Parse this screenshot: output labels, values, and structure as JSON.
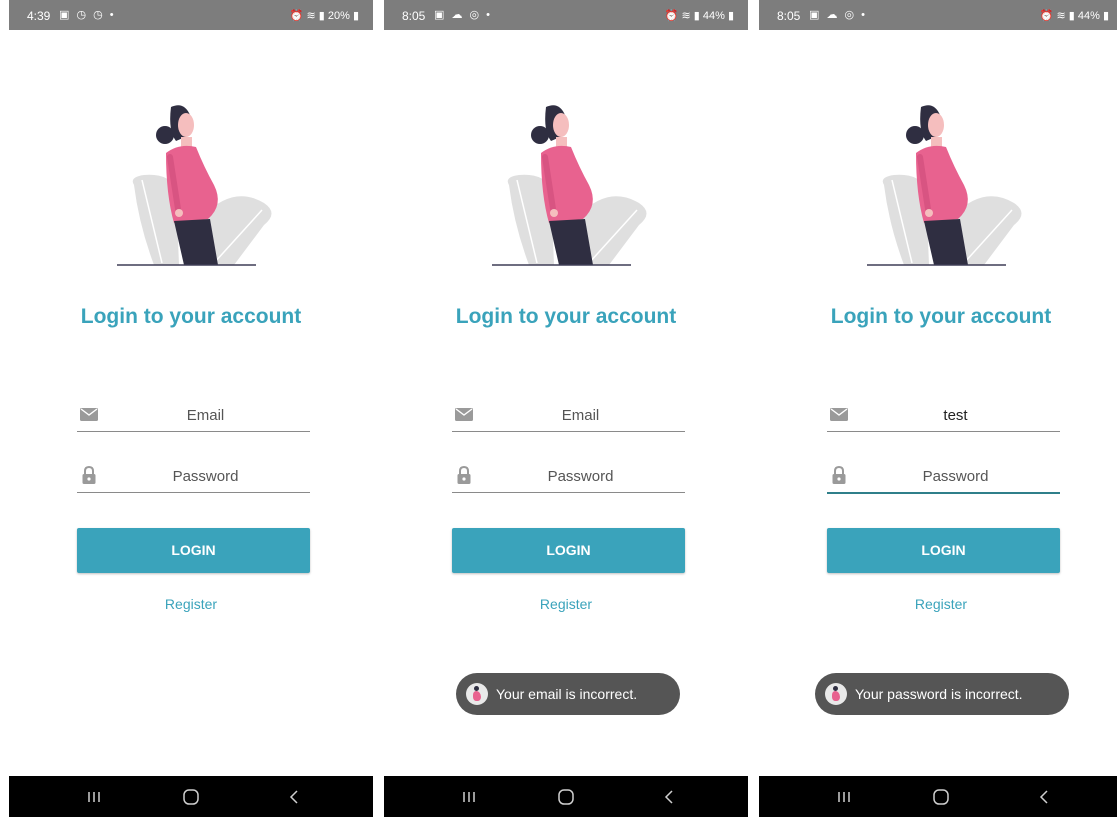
{
  "colors": {
    "accent": "#3aa3bb",
    "statusbar": "#7d7d7d",
    "toast_bg": "#555555",
    "navbar": "#000000",
    "focus_underline": "#2f7f8a"
  },
  "screens": [
    {
      "status": {
        "time": "4:39",
        "battery": "20%"
      },
      "title": "Login to your account",
      "email": {
        "value": "",
        "placeholder": "Email"
      },
      "password": {
        "value": "",
        "placeholder": "Password"
      },
      "login_label": "LOGIN",
      "register_label": "Register",
      "toast": null
    },
    {
      "status": {
        "time": "8:05",
        "battery": "44%"
      },
      "title": "Login to your account",
      "email": {
        "value": "",
        "placeholder": "Email"
      },
      "password": {
        "value": "",
        "placeholder": "Password"
      },
      "login_label": "LOGIN",
      "register_label": "Register",
      "toast": "Your email is incorrect."
    },
    {
      "status": {
        "time": "8:05",
        "battery": "44%"
      },
      "title": "Login to your account",
      "email": {
        "value": "test",
        "placeholder": "Email"
      },
      "password": {
        "value": "",
        "placeholder": "Password",
        "focused": true
      },
      "login_label": "LOGIN",
      "register_label": "Register",
      "toast": "Your password is incorrect."
    }
  ],
  "icons": [
    "email-icon",
    "lock-icon",
    "recent-apps-icon",
    "home-icon",
    "back-icon",
    "alarm-icon",
    "wifi-icon",
    "signal-icon",
    "battery-icon"
  ]
}
